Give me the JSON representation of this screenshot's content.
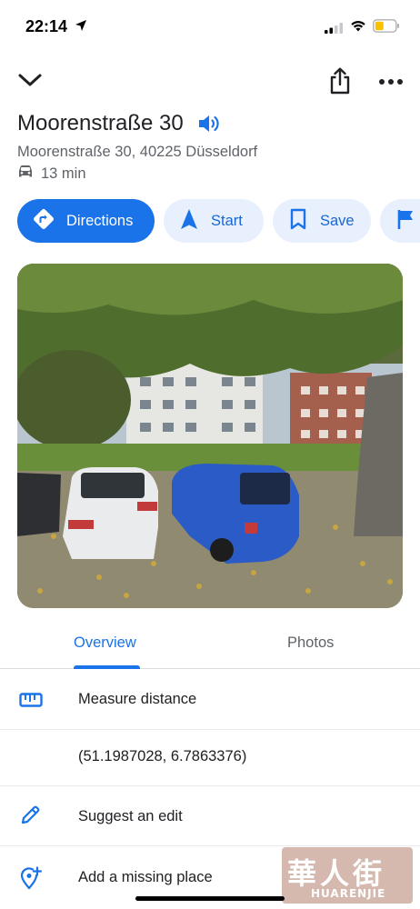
{
  "status_bar": {
    "time": "22:14"
  },
  "place": {
    "title": "Moorenstraße 30",
    "address": "Moorenstraße 30, 40225 Düsseldorf",
    "travel_time": "13 min"
  },
  "actions": {
    "directions": "Directions",
    "start": "Start",
    "save": "Save"
  },
  "tabs": {
    "overview": "Overview",
    "photos": "Photos",
    "selected": "Overview"
  },
  "details": {
    "measure_distance": "Measure distance",
    "coordinates": "(51.1987028, 6.7863376)",
    "suggest_edit": "Suggest an edit",
    "add_missing_place": "Add a missing place"
  },
  "watermark": {
    "chars": "華人街",
    "sub": "HUARENJIE"
  },
  "colors": {
    "accent": "#1a73e8",
    "chip_bg": "#e8f0fe",
    "secondary_text": "#5f6368",
    "battery": "#f9c200"
  }
}
